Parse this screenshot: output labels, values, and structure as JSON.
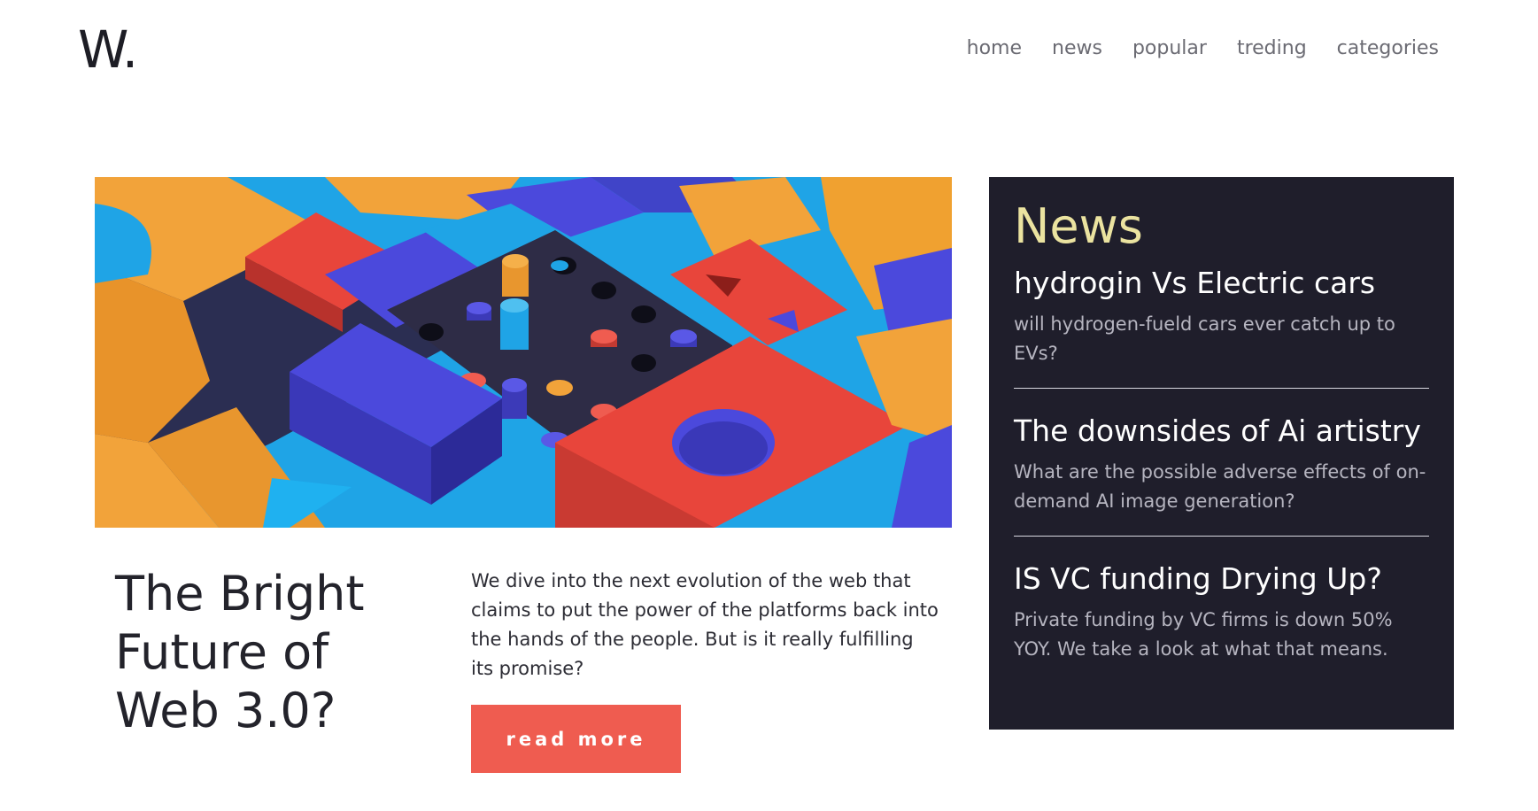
{
  "header": {
    "logo": "W.",
    "nav": [
      "home",
      "news",
      "popular",
      "treding",
      "categories"
    ]
  },
  "article": {
    "title": "The Bright Future of Web 3.0?",
    "description": "We dive into the next evolution of the web that claims to put the power of the platforms back into the hands of the people. But is it really fulfilling its promise?",
    "button_label": "read more"
  },
  "news": {
    "heading": "News",
    "items": [
      {
        "title": "hydrogin Vs Electric cars",
        "description": "will hydrogen-fueld cars ever catch up to EVs?"
      },
      {
        "title": "The downsides of Ai artistry",
        "description": "What are the possible adverse effects of on-demand AI image generation?"
      },
      {
        "title": "IS VC funding Drying Up?",
        "description": "Private funding by VC firms is down 50% YOY. We take a look at what that means."
      }
    ]
  },
  "colors": {
    "accent": "#ef5c50",
    "panel": "#1f1e2b",
    "news_heading": "#ebe3a0"
  }
}
